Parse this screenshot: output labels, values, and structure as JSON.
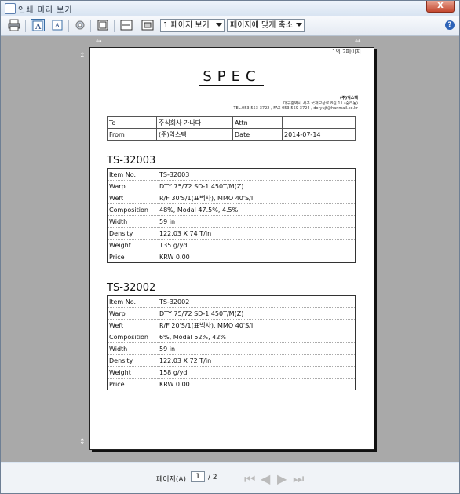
{
  "window": {
    "title": "인쇄 미리 보기",
    "close": "X"
  },
  "toolbar": {
    "view_mode": "1 페이지 보기",
    "zoom_mode": "페이지에 맞게 축소",
    "help": "?"
  },
  "page": {
    "page_indicator": "1의 2페이지",
    "title": "SPEC",
    "company": "(주)익스텍",
    "address": "대구광역시 서구 국채보상로 8길 11 (중리동)",
    "contact": "TEL.053-553-3722 , FAX 053-559-3724 , doryujt@hanmail.co.kr",
    "header": {
      "to_label": "To",
      "to_value": "주식회사 가나다",
      "attn_label": "Attn",
      "attn_value": "",
      "from_label": "From",
      "from_value": "(주)익스텍",
      "date_label": "Date",
      "date_value": "2014-07-14"
    },
    "sections": [
      {
        "title": "TS-32003",
        "rows": [
          {
            "k": "Item No.",
            "v": "TS-32003"
          },
          {
            "k": "Warp",
            "v": "DTY 75/72 SD-1.450T/M(Z)"
          },
          {
            "k": "Weft",
            "v": "R/F 30'S/1(표백사), MMO 40'S/I"
          },
          {
            "k": "Composition",
            "v": "48%, Modal 47.5%, 4.5%"
          },
          {
            "k": "Width",
            "v": "59 in"
          },
          {
            "k": "Density",
            "v": "122.03 X 74 T/in"
          },
          {
            "k": "Weight",
            "v": "135 g/yd"
          },
          {
            "k": "Price",
            "v": "KRW 0.00"
          }
        ]
      },
      {
        "title": "TS-32002",
        "rows": [
          {
            "k": "Item No.",
            "v": "TS-32002"
          },
          {
            "k": "Warp",
            "v": "DTY 75/72 SD-1.450T/M(Z)"
          },
          {
            "k": "Weft",
            "v": "R/F 20'S/1(표백사), MMO 40'S/I"
          },
          {
            "k": "Composition",
            "v": "6%, Modal 52%, 42%"
          },
          {
            "k": "Width",
            "v": "59 in"
          },
          {
            "k": "Density",
            "v": "122.03 X 72 T/in"
          },
          {
            "k": "Weight",
            "v": "158 g/yd"
          },
          {
            "k": "Price",
            "v": "KRW 0.00"
          }
        ]
      }
    ]
  },
  "status": {
    "page_label": "페이지(A)",
    "page_value": "1",
    "page_total": "/ 2"
  }
}
